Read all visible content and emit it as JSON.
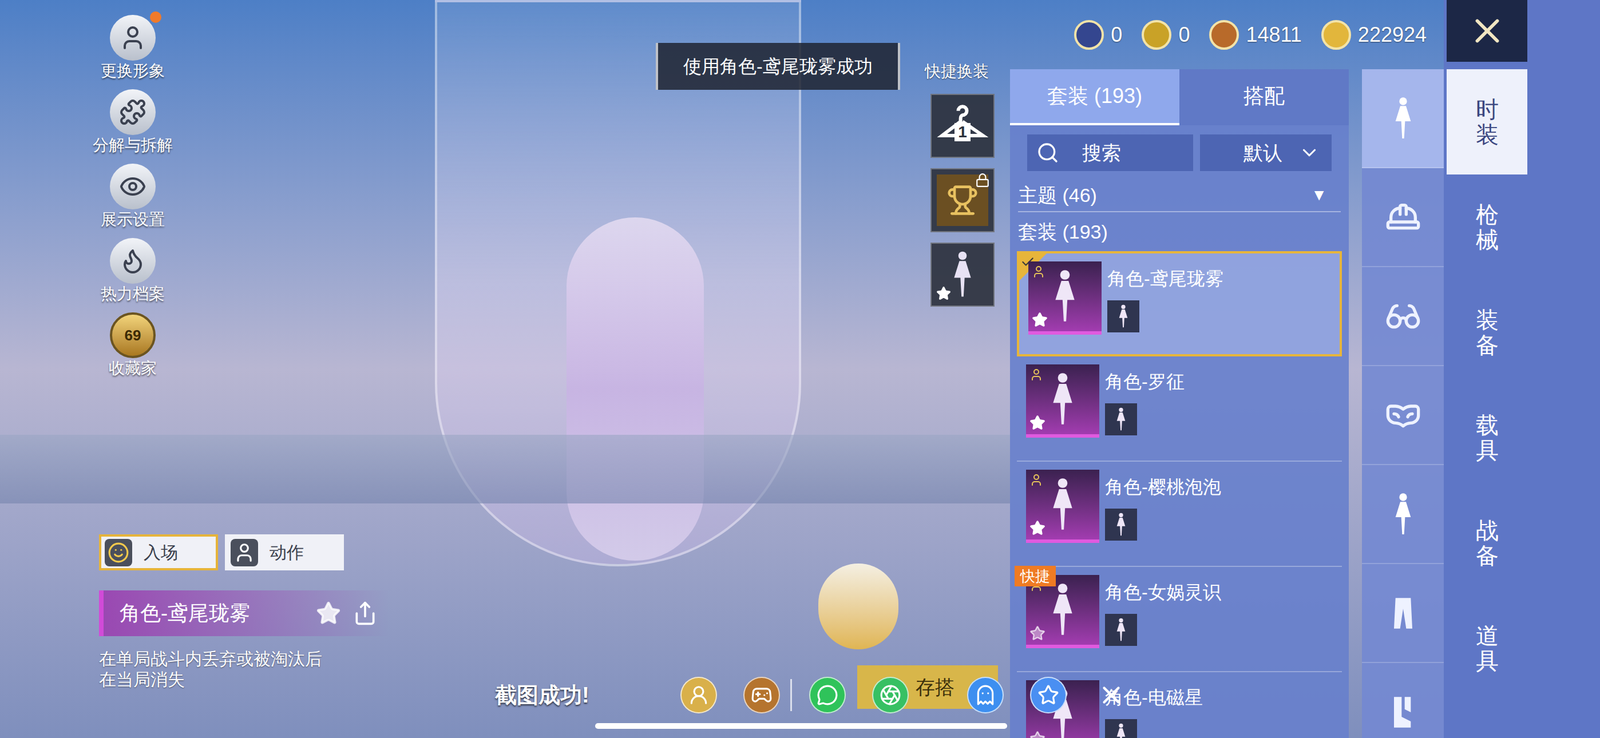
{
  "toast": "使用角色-鸢尾珑雾成功",
  "quick_outfit": {
    "label": "快捷换装",
    "slots": [
      {
        "kind": "hanger",
        "value": "1",
        "locked": false,
        "starred": false
      },
      {
        "kind": "trophy",
        "value": "",
        "locked": true,
        "starred": false
      },
      {
        "kind": "character",
        "value": "",
        "locked": false,
        "starred": true
      }
    ]
  },
  "currencies": [
    {
      "amount": "0",
      "color": "#34468f"
    },
    {
      "amount": "0",
      "color": "#c9a227"
    },
    {
      "amount": "14811",
      "color": "#b86a2a"
    },
    {
      "amount": "222924",
      "color": "#e2b63c"
    }
  ],
  "side_menu": [
    {
      "label": "更换形象",
      "kind": "avatar",
      "dot": true,
      "badge": ""
    },
    {
      "label": "分解与拆解",
      "kind": "puzzle",
      "dot": false,
      "badge": ""
    },
    {
      "label": "展示设置",
      "kind": "eye",
      "dot": false,
      "badge": ""
    },
    {
      "label": "热力档案",
      "kind": "flame",
      "dot": false,
      "badge": ""
    },
    {
      "label": "收藏家",
      "kind": "medal",
      "dot": false,
      "badge": "69"
    }
  ],
  "panel": {
    "tabs": [
      {
        "label": "套装 (193)",
        "selected": true
      },
      {
        "label": "搭配",
        "selected": false
      }
    ],
    "search": {
      "placeholder": "搜索"
    },
    "sort": {
      "value": "默认"
    },
    "theme": {
      "label": "主题 (46)",
      "arrow": "▼",
      "expanded": false
    },
    "section": "套装 (193)",
    "items": [
      {
        "name": "角色-鸢尾珑雾",
        "selected": true,
        "badge": "",
        "starred": true
      },
      {
        "name": "角色-罗征",
        "selected": false,
        "badge": "",
        "starred": true
      },
      {
        "name": "角色-樱桃泡泡",
        "selected": false,
        "badge": "",
        "starred": true
      },
      {
        "name": "角色-女娲灵识",
        "selected": false,
        "badge": "快捷",
        "starred": false
      },
      {
        "name": "角色-电磁星",
        "selected": false,
        "badge": "",
        "starred": false
      }
    ]
  },
  "categories": [
    {
      "kind": "character",
      "selected": true
    },
    {
      "kind": "cap",
      "selected": false
    },
    {
      "kind": "glasses",
      "selected": false
    },
    {
      "kind": "mask",
      "selected": false
    },
    {
      "kind": "character",
      "selected": false
    },
    {
      "kind": "pants",
      "selected": false
    },
    {
      "kind": "boots",
      "selected": false
    }
  ],
  "main_tabs": [
    {
      "label": "时装",
      "selected": true
    },
    {
      "label": "枪械",
      "selected": false
    },
    {
      "label": "装备",
      "selected": false
    },
    {
      "label": "载具",
      "selected": false
    },
    {
      "label": "战备",
      "selected": false
    },
    {
      "label": "道具",
      "selected": false
    }
  ],
  "preview": {
    "buttons": [
      {
        "label": "入场",
        "kind": "entrance",
        "selected": true
      },
      {
        "label": "动作",
        "kind": "action",
        "selected": false
      }
    ],
    "name": "角色-鸢尾珑雾",
    "favorite": false,
    "description": [
      "在单局战斗内丢弃或被淘汰后",
      "在当局消失"
    ]
  },
  "save_button": "存搭",
  "share_bar": {
    "message": "截图成功!",
    "targets": [
      {
        "kind": "friend",
        "color": "#d9b04a"
      },
      {
        "kind": "game",
        "color": "#b5742e"
      },
      {
        "kind": "wechat",
        "color": "#2fc35a"
      },
      {
        "kind": "moments",
        "color": "#37c063"
      },
      {
        "kind": "qq",
        "color": "#3d8ff0"
      },
      {
        "kind": "qzone",
        "color": "#4a8ff2"
      },
      {
        "kind": "close",
        "color": "#2b2b2b"
      }
    ]
  }
}
